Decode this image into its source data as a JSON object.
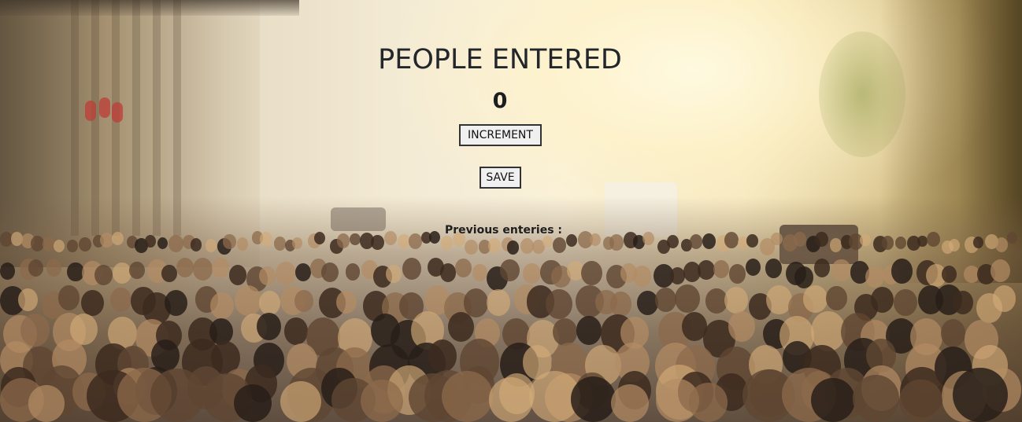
{
  "page": {
    "title": "PEOPLE ENTERED",
    "count": "0"
  },
  "buttons": {
    "increment_label": "INCREMENT",
    "save_label": "SAVE"
  },
  "history": {
    "label": "Previous enteries :",
    "entries": []
  },
  "theme": {
    "text": "#23262a",
    "button_bg": "#f0f0f0",
    "button_border": "#333333"
  }
}
